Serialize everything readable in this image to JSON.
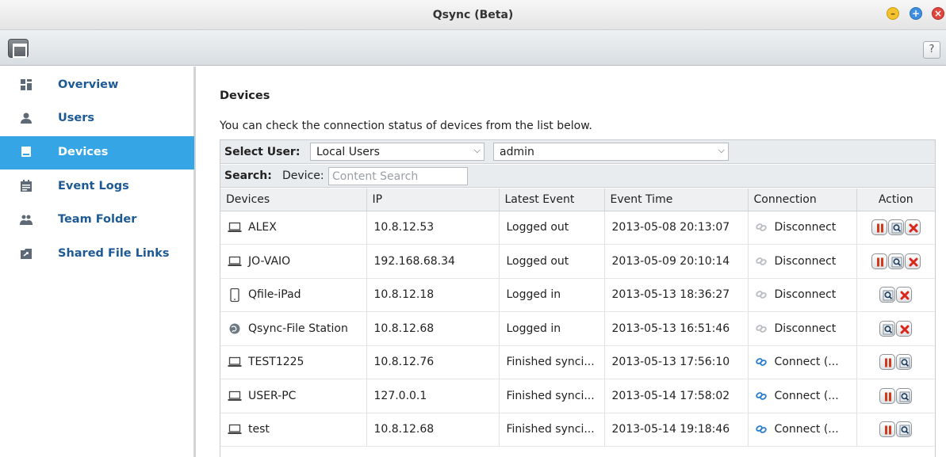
{
  "window": {
    "title": "Qsync (Beta)"
  },
  "toolbar": {
    "help_label": "?"
  },
  "sidebar": {
    "items": [
      {
        "label": "Overview",
        "icon": "overview-icon"
      },
      {
        "label": "Users",
        "icon": "users-icon"
      },
      {
        "label": "Devices",
        "icon": "devices-icon",
        "active": true
      },
      {
        "label": "Event Logs",
        "icon": "event-logs-icon"
      },
      {
        "label": "Team Folder",
        "icon": "team-folder-icon"
      },
      {
        "label": "Shared File Links",
        "icon": "shared-links-icon"
      }
    ]
  },
  "main": {
    "title": "Devices",
    "description": "You can check the connection status of devices from the list below.",
    "filter": {
      "select_user_label": "Select User:",
      "user_type_value": "Local Users",
      "user_value": "admin"
    },
    "search": {
      "label": "Search:",
      "device_label": "Device:",
      "placeholder": "Content Search"
    },
    "table": {
      "columns": [
        "Devices",
        "IP",
        "Latest Event",
        "Event Time",
        "Connection",
        "Action"
      ],
      "rows": [
        {
          "device": "ALEX",
          "device_icon": "laptop-icon",
          "ip": "10.8.12.53",
          "event": "Logged out",
          "time": "2013-05-08 20:13:07",
          "connection": "Disconnect",
          "connected": false,
          "actions": [
            "pause",
            "view",
            "delete"
          ]
        },
        {
          "device": "JO-VAIO",
          "device_icon": "laptop-icon",
          "ip": "192.168.68.34",
          "event": "Logged out",
          "time": "2013-05-09 20:10:14",
          "connection": "Disconnect",
          "connected": false,
          "actions": [
            "pause",
            "view",
            "delete"
          ]
        },
        {
          "device": "Qfile-iPad",
          "device_icon": "tablet-icon",
          "ip": "10.8.12.18",
          "event": "Logged in",
          "time": "2013-05-13 18:36:27",
          "connection": "Disconnect",
          "connected": false,
          "actions": [
            "view",
            "delete"
          ]
        },
        {
          "device": "Qsync-File Station",
          "device_icon": "globe-icon",
          "ip": "10.8.12.68",
          "event": "Logged in",
          "time": "2013-05-13 16:51:46",
          "connection": "Disconnect",
          "connected": false,
          "actions": [
            "view",
            "delete"
          ]
        },
        {
          "device": "TEST1225",
          "device_icon": "laptop-icon",
          "ip": "10.8.12.76",
          "event": "Finished synci...",
          "time": "2013-05-13 17:56:10",
          "connection": "Connect (...",
          "connected": true,
          "actions": [
            "pause",
            "view"
          ]
        },
        {
          "device": "USER-PC",
          "device_icon": "laptop-icon",
          "ip": "127.0.0.1",
          "event": "Finished synci...",
          "time": "2013-05-14 17:58:02",
          "connection": "Connect (...",
          "connected": true,
          "actions": [
            "pause",
            "view"
          ]
        },
        {
          "device": "test",
          "device_icon": "laptop-icon",
          "ip": "10.8.12.68",
          "event": "Finished synci...",
          "time": "2013-05-14 19:18:46",
          "connection": "Connect (...",
          "connected": true,
          "actions": [
            "pause",
            "view"
          ]
        }
      ]
    }
  },
  "colors": {
    "active_nav_bg": "#35a5e6",
    "nav_text": "#1d5a95",
    "connected_icon": "#2b7fd0",
    "disconnected_icon": "#b9bec2",
    "pause_red": "#d23a1e",
    "delete_red": "#d9281b"
  }
}
